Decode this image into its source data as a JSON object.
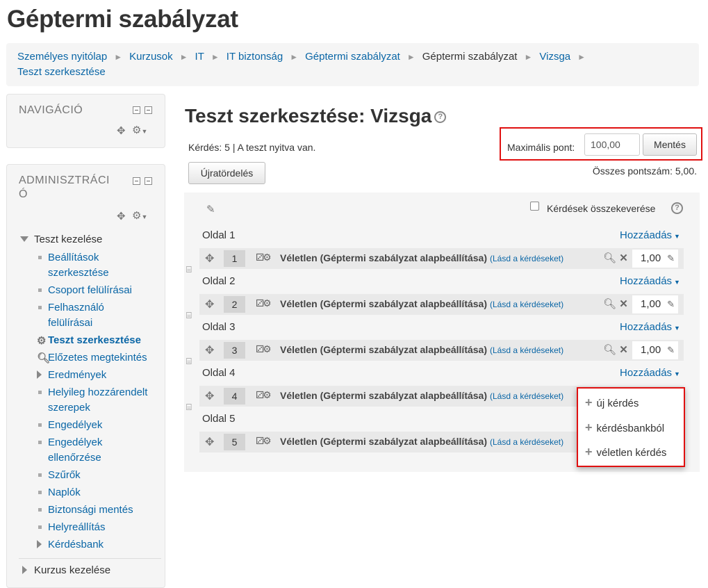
{
  "page": {
    "title": "Géptermi szabályzat"
  },
  "breadcrumb": [
    "Személyes nyitólap",
    "Kurzusok",
    "IT",
    "IT biztonság",
    "Géptermi szabályzat",
    "Géptermi szabályzat",
    "Vizsga",
    "Teszt szerkesztése"
  ],
  "sidebar": {
    "nav_title": "NAVIGÁCIÓ",
    "admin_title_line1": "ADMINISZTRÁCI",
    "admin_title_line2": "Ó",
    "quiz_admin_head": "Teszt kezelése",
    "items": [
      "Beállítások",
      "szerkesztése",
      "Csoport felülírásai",
      "Felhasználó",
      "felülírásai",
      "Teszt szerkesztése",
      "Előzetes megtekintés",
      "Eredmények",
      "Helyileg hozzárendelt",
      "szerepek",
      "Engedélyek",
      "Engedélyek",
      "ellenőrzése",
      "Szűrők",
      "Naplók",
      "Biztonsági mentés",
      "Helyreállítás",
      "Kérdésbank"
    ],
    "course_admin_head": "Kurzus kezelése"
  },
  "main": {
    "heading": "Teszt szerkesztése: Vizsga",
    "status": "Kérdés: 5 | A teszt nyitva van.",
    "max_grade_label": "Maximális pont:",
    "max_grade_value": "100,00",
    "save_label": "Mentés",
    "repaginate_label": "Újratördelés",
    "total_marks": "Összes pontszám: 5,00.",
    "shuffle_label": "Kérdések összekeverése",
    "add_label": "Hozzáadás",
    "pages": [
      {
        "label": "Oldal 1",
        "slot": {
          "number": "1",
          "title": "Véletlen (Géptermi szabályzat alapbeállítása)",
          "see": "(Lásd a kérdéseket)",
          "mark": "1,00"
        }
      },
      {
        "label": "Oldal 2",
        "slot": {
          "number": "2",
          "title": "Véletlen (Géptermi szabályzat alapbeállítása)",
          "see": "(Lásd a kérdéseket)",
          "mark": "1,00"
        }
      },
      {
        "label": "Oldal 3",
        "slot": {
          "number": "3",
          "title": "Véletlen (Géptermi szabályzat alapbeállítása)",
          "see": "(Lásd a kérdéseket)",
          "mark": "1,00"
        }
      },
      {
        "label": "Oldal 4",
        "slot": {
          "number": "4",
          "title": "Véletlen (Géptermi szabályzat alapbeállítása)",
          "see": "(Lásd a kérdéseket)",
          "mark": ""
        }
      },
      {
        "label": "Oldal 5",
        "slot": {
          "number": "5",
          "title": "Véletlen (Géptermi szabályzat alapbeállítása)",
          "see": "(Lásd a kérdéseket)",
          "mark": ""
        }
      }
    ],
    "add_menu": [
      "új kérdés",
      "kérdésbankból",
      "véletlen kérdés"
    ]
  },
  "icons": {
    "move": "move-icon",
    "gear": "gear-icon",
    "search": "search-icon",
    "delete": "delete-icon",
    "edit": "pencil-icon",
    "help": "help-icon",
    "page-break": "page-break-icon"
  },
  "colors": {
    "link": "#0a66a6",
    "highlight_border": "#e01010",
    "panel_bg": "#f5f5f5"
  }
}
